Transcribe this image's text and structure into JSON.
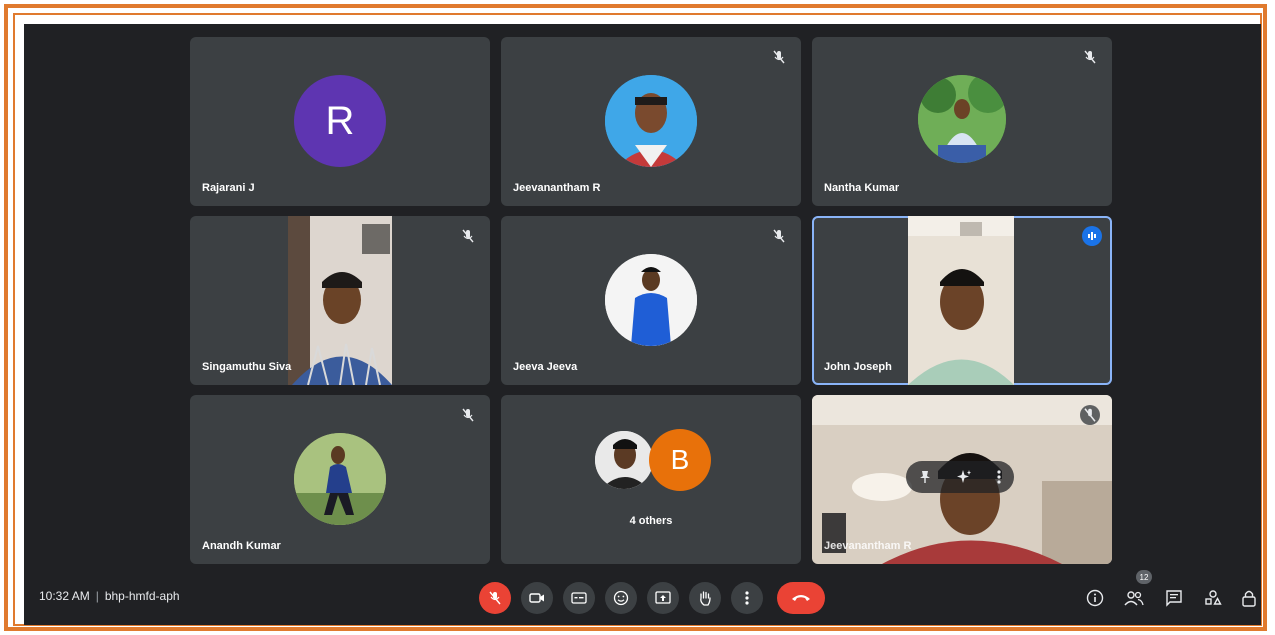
{
  "meeting": {
    "time": "10:32 AM",
    "code": "bhp-hmfd-aph",
    "participants_count": "12"
  },
  "tiles": [
    {
      "name": "Rajarani J",
      "avatar_letter": "R",
      "avatar_color": "#5e35b1",
      "mic": "muted"
    },
    {
      "name": "Jeevanantham R",
      "mic": "muted"
    },
    {
      "name": "Nantha Kumar",
      "mic": "muted"
    },
    {
      "name": "Singamuthu Siva",
      "mic": "muted"
    },
    {
      "name": "Jeeva Jeeva",
      "mic": "muted"
    },
    {
      "name": "John Joseph",
      "mic": "speaking"
    },
    {
      "name": "Anandh Kumar",
      "mic": "muted"
    },
    {
      "others_label": "4 others",
      "avatar_letter": "B",
      "avatar_color": "#e8710a"
    },
    {
      "name": "Jeevanantham R",
      "mic": "muted"
    }
  ],
  "controls": [
    {
      "name": "microphone-off",
      "icon": "mic-off-icon"
    },
    {
      "name": "camera",
      "icon": "video-icon"
    },
    {
      "name": "captions",
      "icon": "captions-icon"
    },
    {
      "name": "reactions",
      "icon": "emoji-icon"
    },
    {
      "name": "present",
      "icon": "present-icon"
    },
    {
      "name": "raise-hand",
      "icon": "hand-icon"
    },
    {
      "name": "more-options",
      "icon": "more-vert-icon"
    },
    {
      "name": "leave-call",
      "icon": "hangup-icon"
    }
  ],
  "right_controls": [
    "info-icon",
    "people-icon",
    "chat-icon",
    "activities-icon",
    "lock-icon"
  ],
  "colors": {
    "background": "#202124",
    "tile": "#3c4043",
    "accent_red": "#ea4335",
    "active_border": "#8ab4f8",
    "frame": "#e07a2e"
  }
}
